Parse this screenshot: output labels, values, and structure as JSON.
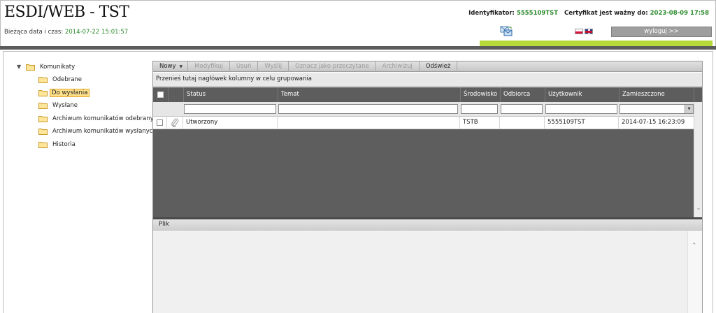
{
  "header": {
    "app_title": "ESDI/WEB - TST",
    "datetime_label": "Bieżąca data i czas:",
    "datetime_value": "2014-07-22 15:01:57",
    "identifier_label": "Identyfikator:",
    "identifier_value": "5555109TST",
    "cert_label": "Certyfikat jest ważny do:",
    "cert_value": "2023-08-09 17:58",
    "logout_label": "wyloguj >>",
    "icons": [
      "mail-transfer-icon",
      "flag-pl-icon",
      "flag-uk-icon"
    ],
    "accent_color": "#b5da3a"
  },
  "tree": {
    "root": "Komunikaty",
    "items": [
      {
        "label": "Odebrane",
        "selected": false
      },
      {
        "label": "Do wysłania",
        "selected": true
      },
      {
        "label": "Wysłane",
        "selected": false
      },
      {
        "label": "Archiwum komunikatów odebranych",
        "selected": false
      },
      {
        "label": "Archiwum komunikatów wysłanych",
        "selected": false
      },
      {
        "label": "Historia",
        "selected": false
      }
    ]
  },
  "toolbar": {
    "buttons": [
      {
        "label": "Nowy",
        "enabled": true
      },
      {
        "label": "Modyfikuj",
        "enabled": false
      },
      {
        "label": "Usuń",
        "enabled": false
      },
      {
        "label": "Wyślij",
        "enabled": false
      },
      {
        "label": "Oznacz jako przeczytane",
        "enabled": false
      },
      {
        "label": "Archiwizuj",
        "enabled": false
      },
      {
        "label": "Odśwież",
        "enabled": true
      }
    ]
  },
  "grid": {
    "group_hint": "Przenieś tutaj nagłówek kolumny w celu grupowania",
    "columns": [
      "Status",
      "Temat",
      "Środowisko",
      "Odbiorca",
      "Użytkownik",
      "Zamieszczone"
    ],
    "rows": [
      {
        "status": "Utworzony",
        "temat": "",
        "srodowisko": "TSTB",
        "odbiorca": "",
        "uzytkownik": "5555109TST",
        "zamieszczone": "2014-07-15 16:23:09"
      }
    ]
  },
  "file_panel": {
    "title": "Plik"
  }
}
